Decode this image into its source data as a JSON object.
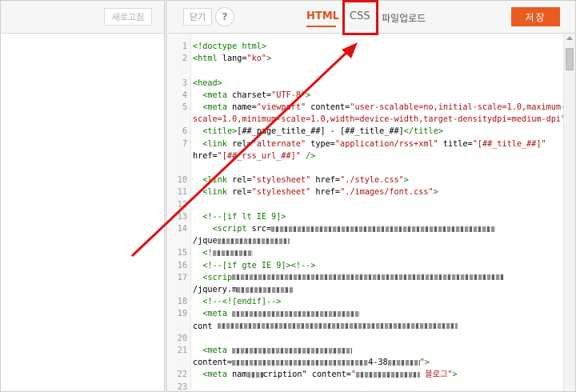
{
  "left_toolbar": {
    "refresh_label": "새로고침"
  },
  "right_toolbar": {
    "close_label": "닫기",
    "help_label": "?",
    "tabs": [
      {
        "label": "HTML",
        "active": true
      },
      {
        "label": "CSS",
        "active": false
      },
      {
        "label": "파일업로드",
        "active": false
      }
    ],
    "save_label": "저장"
  },
  "colors": {
    "accent": "#ea5b1f",
    "highlight": "#e01010"
  },
  "code_lines": [
    {
      "n": "1",
      "html": "<span class=\"tag\">&lt;!doctype html&gt;</span>"
    },
    {
      "n": "2",
      "html": "<span class=\"tag\">&lt;html</span> <span class=\"attr\">lang=</span><span class=\"str\">\"ko\"</span><span class=\"tag\">&gt;</span>"
    },
    {
      "n": "",
      "html": ""
    },
    {
      "n": "3",
      "html": "<span class=\"tag\">&lt;head&gt;</span>"
    },
    {
      "n": "4",
      "html": "  <span class=\"tag\">&lt;meta</span> <span class=\"attr\">charset=</span><span class=\"str\">\"UTF-8\"</span><span class=\"tag\">&gt;</span>"
    },
    {
      "n": "5",
      "html": "  <span class=\"tag\">&lt;meta</span> <span class=\"attr\">name=</span><span class=\"str\">\"viewport\"</span> <span class=\"attr\">content=</span><span class=\"str\">\"user-scalable=no,initial-scale=1.0,maximum-</span>"
    },
    {
      "n": "",
      "html": "<span class=\"str\">scale=1.0,minimum-scale=1.0,width=device-width,target-densitydpi=medium-dpi\"</span><span class=\"tag\">&gt;</span>"
    },
    {
      "n": "6",
      "html": "  <span class=\"tag\">&lt;title&gt;</span>[##_page_title_##] - [##_title_##]<span class=\"tag\">&lt;/title&gt;</span>"
    },
    {
      "n": "7",
      "html": "  <span class=\"tag\">&lt;link</span> <span class=\"attr\">rel=</span><span class=\"str\">\"alternate\"</span> <span class=\"attr\">type=</span><span class=\"str\">\"application/rss+xml\"</span> <span class=\"attr\">title=</span><span class=\"str\">\"[##_title_##]\"</span>"
    },
    {
      "n": "",
      "html": "<span class=\"attr\">href=</span><span class=\"str\">\"[##_rss_url_##]\"</span> <span class=\"tag\">/&gt;</span>"
    },
    {
      "n": "",
      "html": ""
    },
    {
      "n": "10",
      "html": "  <span class=\"tag\">&lt;link</span> <span class=\"attr\">rel=</span><span class=\"str\">\"stylesheet\"</span> <span class=\"attr\">href=</span><span class=\"str\">\"./style.css\"</span><span class=\"tag\">&gt;</span>"
    },
    {
      "n": "11",
      "html": "  <span class=\"tag\">&lt;link</span> <span class=\"attr\">rel=</span><span class=\"str\">\"stylesheet\"</span> <span class=\"attr\">href=</span><span class=\"str\">\"./images/font.css\"</span><span class=\"tag\">&gt;</span>"
    },
    {
      "n": "12",
      "html": ""
    },
    {
      "n": "13",
      "html": "  <span class=\"cmt\">&lt;!--[if lt IE 9]&gt;</span>"
    },
    {
      "n": "14",
      "html": "    <span class=\"tag\">&lt;script</span> <span class=\"attr\">src=</span><span class=\"blur\" style=\"width:280px\"></span>"
    },
    {
      "n": "",
      "html": "/jque<span class=\"blur\" style=\"width:90px\"></span>"
    },
    {
      "n": "15",
      "html": "  <span class=\"cmt\">&lt;!</span><span class=\"blur\" style=\"width:50px\"></span>"
    },
    {
      "n": "16",
      "html": "  <span class=\"cmt\">&lt;!--[if gte IE 9]&gt;&lt;!--&gt;</span>"
    },
    {
      "n": "17",
      "html": "  <span class=\"tag\">&lt;scrip</span><span class=\"blur\" style=\"width:340px\"></span>"
    },
    {
      "n": "",
      "html": "/jquery.m<span class=\"blur\" style=\"width:70px\"></span>"
    },
    {
      "n": "18",
      "html": "  <span class=\"cmt\">&lt;!--&lt;![endif]--&gt;</span>"
    },
    {
      "n": "19",
      "html": "  <span class=\"tag\">&lt;meta</span> <span class=\"blur\" style=\"width:160px\"></span>"
    },
    {
      "n": "",
      "html": "cont <span class=\"blur\" style=\"width:300px\"></span>"
    },
    {
      "n": "20",
      "html": ""
    },
    {
      "n": "21",
      "html": "  <span class=\"tag\">&lt;meta</span> <span class=\"blur\" style=\"width:150px\"></span>"
    },
    {
      "n": "",
      "html": "content=<span class=\"blur\" style=\"width:170px\"></span>4-38<span class=\"blur\" style=\"width:40px\"></span><span class=\"str\">\"</span><span class=\"tag\">&gt;</span>"
    },
    {
      "n": "22",
      "html": "  <span class=\"tag\">&lt;meta</span> <span class=\"attr\">nam</span><span class=\"blur\" style=\"width:20px\"></span><span class=\"attr\">cription\"</span> <span class=\"attr\">content=</span><span class=\"str\">\"</span><span class=\"blur\" style=\"width:80px\"></span> <span class=\"str\">블로그\"</span><span class=\"tag\">&gt;</span>"
    },
    {
      "n": "23",
      "html": ""
    }
  ]
}
